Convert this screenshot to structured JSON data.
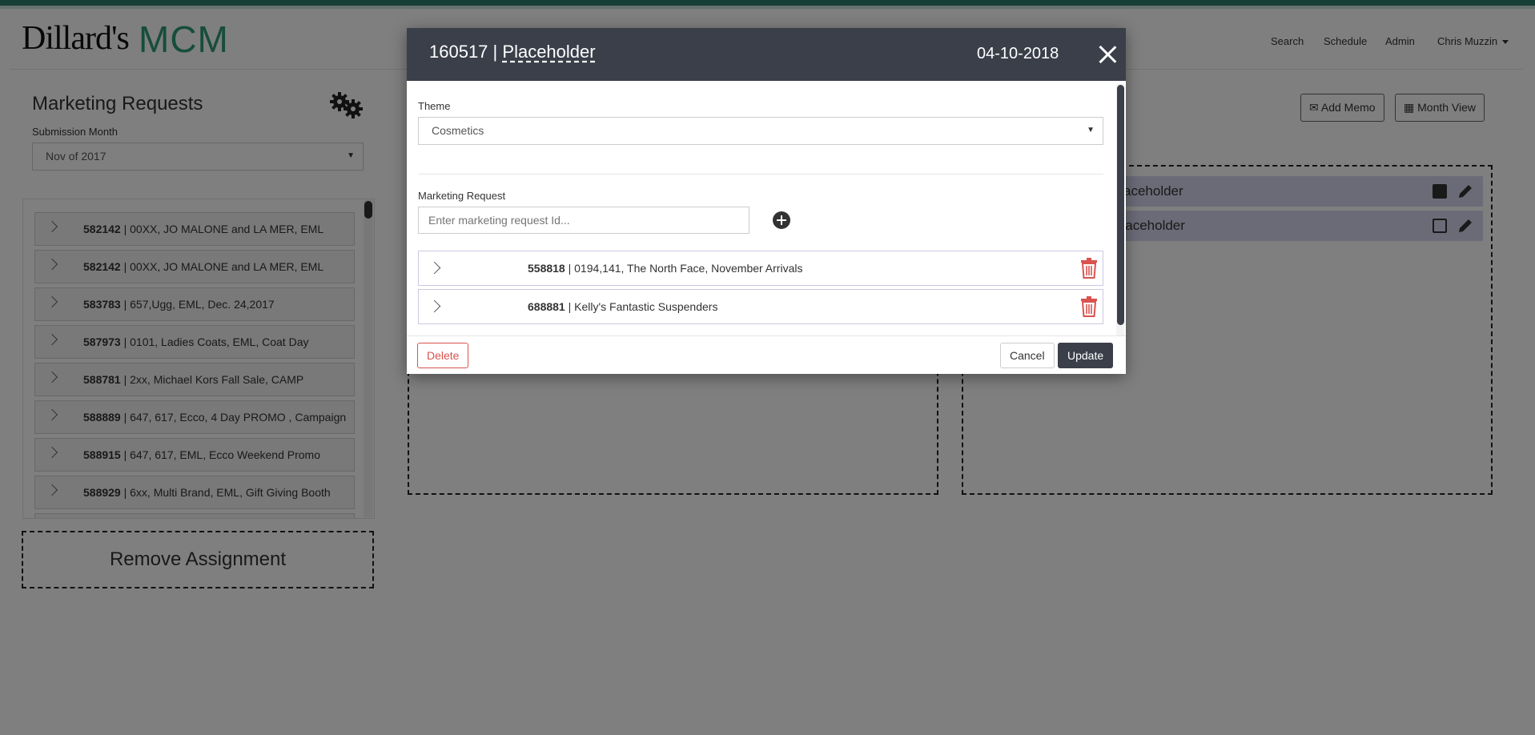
{
  "header": {
    "logo": "Dillard's",
    "app_name": "MCM",
    "nav": [
      "Search",
      "Schedule",
      "Admin",
      "Chris Muzzin"
    ]
  },
  "sidebar": {
    "title": "Marketing Requests",
    "submission_label": "Submission Month",
    "submission_value": "Nov of 2017",
    "items": [
      {
        "id": "582142",
        "desc": "| 00XX, JO MALONE and LA MER, EML"
      },
      {
        "id": "582142",
        "desc": "| 00XX, JO MALONE and LA MER, EML"
      },
      {
        "id": "583783",
        "desc": "| 657,Ugg, EML, Dec. 24,2017"
      },
      {
        "id": "587973",
        "desc": "| 0101, Ladies Coats, EML, Coat Day"
      },
      {
        "id": "588781",
        "desc": "| 2xx, Michael Kors Fall Sale, CAMP"
      },
      {
        "id": "588889",
        "desc": "| 647, 617, Ecco, 4 Day PROMO , Campaign"
      },
      {
        "id": "588915",
        "desc": "| 647, 617, EML, Ecco Weekend Promo"
      },
      {
        "id": "588929",
        "desc": "| 6xx, Multi Brand, EML, Gift Giving Booth"
      }
    ],
    "remove_label": "Remove Assignment"
  },
  "main": {
    "add_memo_label": "Add Memo",
    "month_view_label": "Month View",
    "placeholders": [
      "aceholder",
      "| Placeholder"
    ]
  },
  "modal": {
    "id": "160517",
    "separator": "|",
    "name": "Placeholder",
    "date": "04-10-2018",
    "theme_label": "Theme",
    "theme_value": "Cosmetics",
    "marketing_label": "Marketing Request",
    "marketing_placeholder": "Enter marketing request Id...",
    "requests": [
      {
        "id": "558818",
        "desc": "| 0194,141, The North Face, November Arrivals"
      },
      {
        "id": "688881",
        "desc": "| Kelly's Fantastic Suspenders"
      }
    ],
    "delete_label": "Delete",
    "cancel_label": "Cancel",
    "update_label": "Update"
  },
  "colors": {
    "brand": "#2e9b76",
    "header_bar": "#2f7d68",
    "modal_header": "#3a3f4a",
    "danger": "#d9534f",
    "placeholder_row": "#d6d6f0"
  }
}
